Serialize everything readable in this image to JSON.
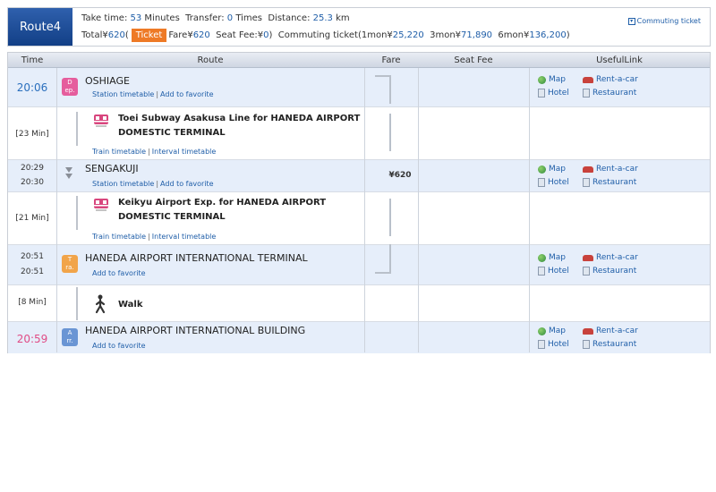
{
  "summary": {
    "route_label": "Route4",
    "take_time_label": "Take time:",
    "take_time_value": "53",
    "take_time_unit": "Minutes",
    "transfer_label": "Transfer:",
    "transfer_value": "0",
    "transfer_unit": "Times",
    "distance_label": "Distance:",
    "distance_value": "25.3",
    "distance_unit": "km",
    "total_label": "Total¥",
    "total_value": "620",
    "ticket_badge": "Ticket",
    "fare_label": "Fare¥",
    "fare_value": "620",
    "seat_fee_label": "Seat Fee:¥",
    "seat_fee_value": "0",
    "commuting_label": "Commuting ticket(1mon¥",
    "one_mon_value": "25,220",
    "three_mon_label": "3mon¥",
    "three_mon_value": "71,890",
    "six_mon_label": "6mon¥",
    "six_mon_value": "136,200",
    "commuting_link": "Commuting ticket"
  },
  "table": {
    "headers": {
      "time": "Time",
      "route": "Route",
      "fare": "Fare",
      "seat_fee": "Seat Fee",
      "useful_link": "UsefulLink"
    },
    "station_links": {
      "station_timetable": "Station timetable",
      "add_favorite": "Add to favorite"
    },
    "segment_links": {
      "train_timetable": "Train timetable",
      "interval_timetable": "Interval timetable"
    },
    "useful_links": {
      "map": "Map",
      "rent_a_car": "Rent-a-car",
      "hotel": "Hotel",
      "restaurant": "Restaurant"
    },
    "fare_value": "¥620",
    "stations": [
      {
        "time": "20:06",
        "badge_top": "D",
        "badge_bottom": "ep.",
        "name": "OSHIAGE"
      },
      {
        "time_arr": "20:29",
        "time_dep": "20:30",
        "name": "SENGAKUJI"
      },
      {
        "time_arr": "20:51",
        "time_dep": "20:51",
        "badge_top": "T",
        "badge_bottom": "ra.",
        "name": "HANEDA AIRPORT INTERNATIONAL TERMINAL"
      },
      {
        "time": "20:59",
        "badge_top": "A",
        "badge_bottom": "rr.",
        "name": "HANEDA AIRPORT INTERNATIONAL BUILDING"
      }
    ],
    "segments": [
      {
        "duration": "[23 Min]",
        "line": "Toei Subway Asakusa Line  for HANEDA AIRPORT DOMESTIC TERMINAL"
      },
      {
        "duration": "[21 Min]",
        "line": "Keikyu Airport Exp.  for HANEDA AIRPORT DOMESTIC TERMINAL"
      },
      {
        "duration": "[8 Min]",
        "line": "Walk"
      }
    ]
  },
  "colors": {
    "header_blue": "#1a4a96",
    "ticket_orange": "#ee7a26",
    "link_blue": "#1f5ea8",
    "arrival_pink": "#e04c86",
    "row_blue": "#e6eefa"
  }
}
